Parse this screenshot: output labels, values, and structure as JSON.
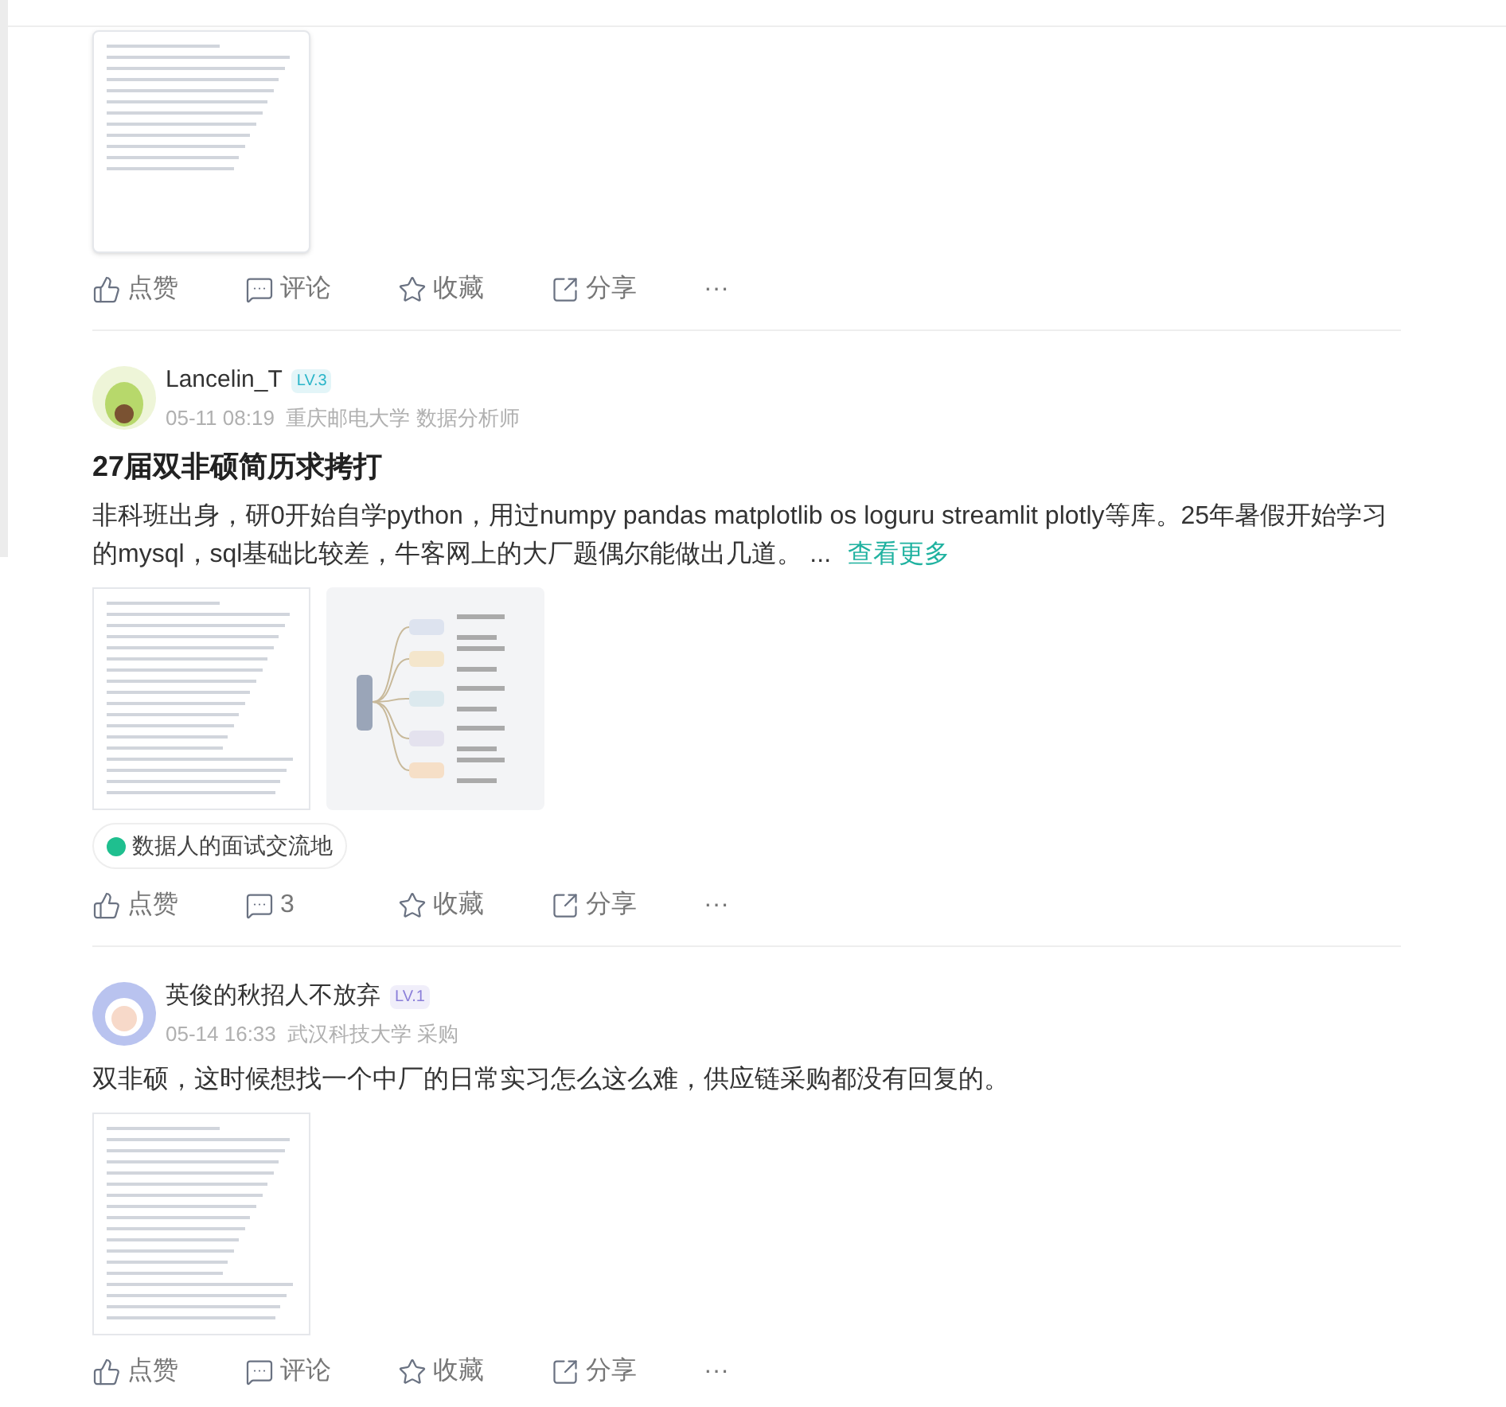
{
  "posts": [
    {
      "images": [
        {
          "kind": "notice"
        }
      ],
      "actions": [
        {
          "kind": "like",
          "label": "点赞"
        },
        {
          "kind": "comment",
          "label": "评论"
        },
        {
          "kind": "favorite",
          "label": "收藏"
        },
        {
          "kind": "share",
          "label": "分享"
        },
        {
          "kind": "more",
          "label": "···"
        }
      ]
    },
    {
      "author": {
        "name": "Lancelin_T",
        "badge": {
          "label": "LV.3",
          "color": "#2bb5c9"
        },
        "meta": "05-11 08:19  重庆邮电大学 数据分析师",
        "avatar": {
          "kind": "avocado"
        }
      },
      "title": "27届双非硕简历求拷打",
      "body": "非科班出身，研0开始自学python，用过numpy pandas matplotlib os loguru streamlit plotly等库。25年暑假开始学习的mysql，sql基础比较差，牛客网上的大厂题偶尔能做出几道。 ...",
      "more_link": "查看更多",
      "images": [
        {
          "kind": "resume"
        },
        {
          "kind": "mindmap"
        }
      ],
      "tag": "数据人的面试交流地",
      "actions": [
        {
          "kind": "like",
          "label": "点赞"
        },
        {
          "kind": "comment",
          "label": "3"
        },
        {
          "kind": "favorite",
          "label": "收藏"
        },
        {
          "kind": "share",
          "label": "分享"
        },
        {
          "kind": "more",
          "label": "···"
        }
      ]
    },
    {
      "author": {
        "name": "英俊的秋招人不放弃",
        "badge": {
          "label": "LV.1",
          "color": "#8b7fd9"
        },
        "meta": "05-14 16:33  武汉科技大学 采购",
        "avatar": {
          "kind": "astronaut"
        }
      },
      "body": "双非硕，这时候想找一个中厂的日常实习怎么这么难，供应链采购都没有回复的。",
      "images": [
        {
          "kind": "resume"
        }
      ],
      "actions": [
        {
          "kind": "like",
          "label": "点赞"
        },
        {
          "kind": "comment",
          "label": "评论"
        },
        {
          "kind": "favorite",
          "label": "收藏"
        },
        {
          "kind": "share",
          "label": "分享"
        },
        {
          "kind": "more",
          "label": "···"
        }
      ]
    }
  ]
}
